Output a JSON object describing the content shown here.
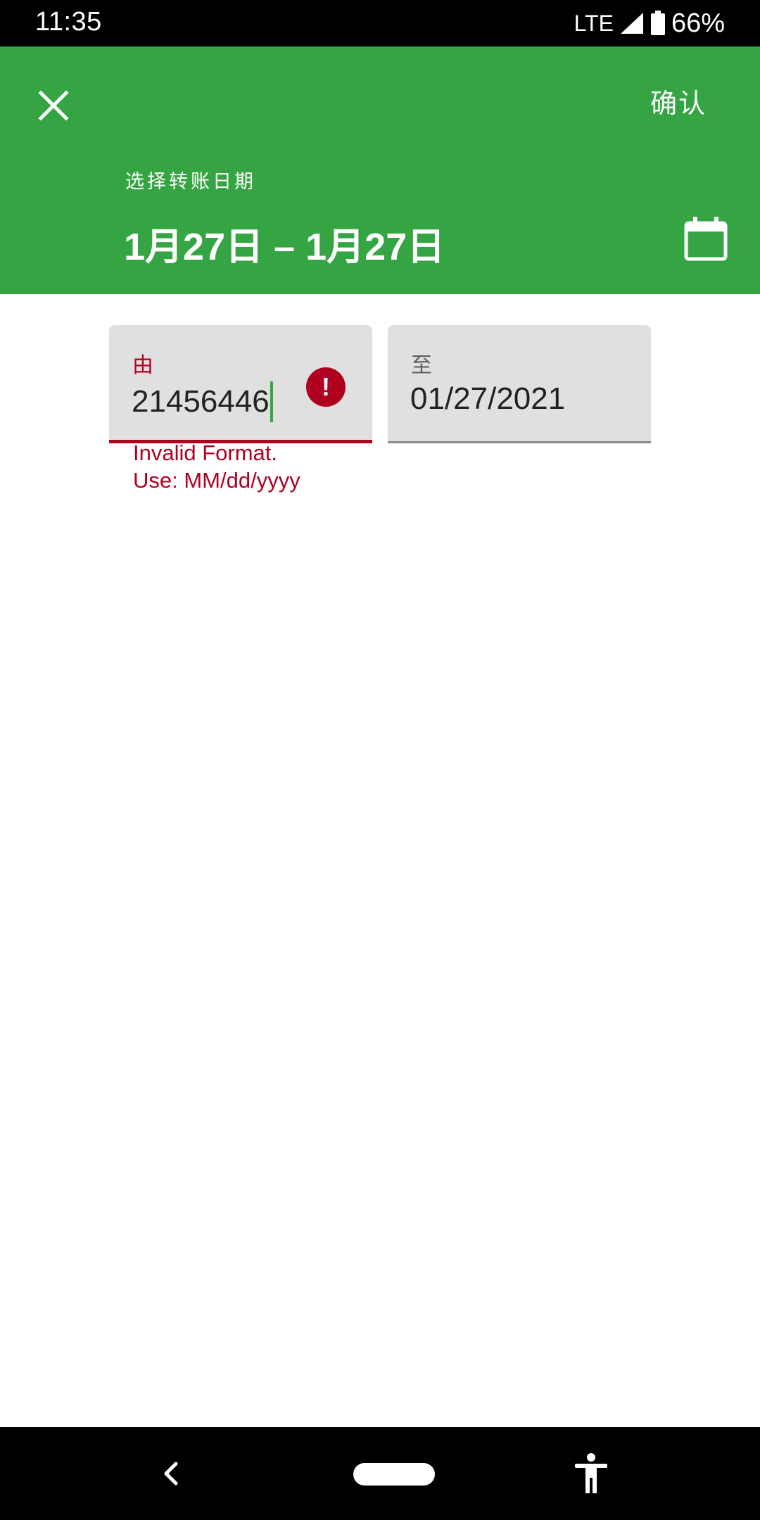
{
  "status_bar": {
    "time": "11:35",
    "network": "LTE",
    "battery_percent": "66%",
    "icons": [
      "signal-icon",
      "battery-icon"
    ]
  },
  "header": {
    "close_icon": "close-icon",
    "confirm_label": "确认",
    "subtitle": "选择转账日期",
    "date_range": "1月27日 – 1月27日",
    "calendar_icon": "calendar-icon",
    "background_color": "#35a543"
  },
  "from_field": {
    "label": "由",
    "value": "21456446",
    "error_icon": "error-icon",
    "error_message": "Invalid Format.\nUse: MM/dd/yyyy",
    "error_color": "#b00020"
  },
  "to_field": {
    "label": "至",
    "value": "01/27/2021"
  },
  "nav_bar": {
    "icons": [
      "back-icon",
      "home-pill",
      "accessibility-icon"
    ]
  }
}
